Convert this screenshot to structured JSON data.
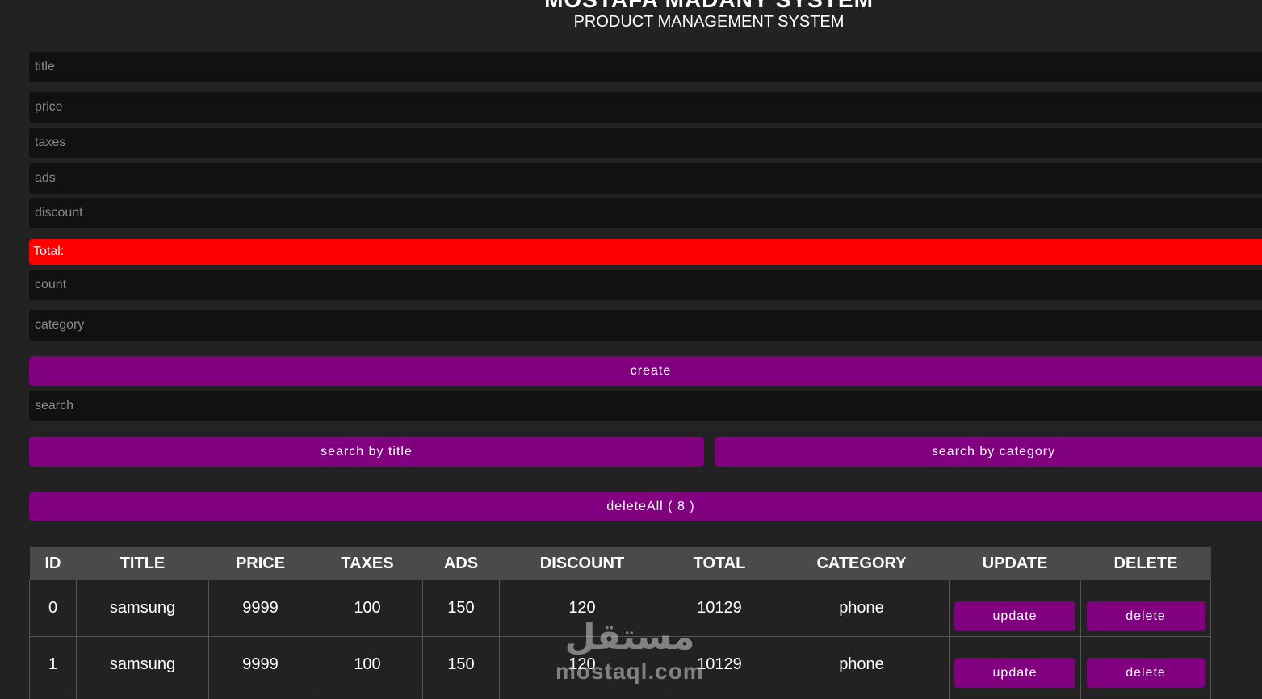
{
  "header": {
    "title": "MOSTAFA MADANY SYSTEM",
    "subtitle": "PRODUCT MANAGEMENT SYSTEM"
  },
  "form": {
    "title_placeholder": "title",
    "price_placeholder": "price",
    "taxes_placeholder": "taxes",
    "ads_placeholder": "ads",
    "discount_placeholder": "discount",
    "total_label": "Total:",
    "count_placeholder": "count",
    "category_placeholder": "category",
    "create_label": "create"
  },
  "search": {
    "placeholder": "search",
    "by_title_label": "search by title",
    "by_category_label": "search by category"
  },
  "delete_all_label": "deleteAll ( 8 )",
  "table": {
    "headers": [
      "ID",
      "TITLE",
      "PRICE",
      "TAXES",
      "ADS",
      "DISCOUNT",
      "TOTAL",
      "CATEGORY",
      "UPDATE",
      "DELETE"
    ],
    "rows": [
      {
        "id": "0",
        "title": "samsung",
        "price": "9999",
        "taxes": "100",
        "ads": "150",
        "discount": "120",
        "total": "10129",
        "category": "phone",
        "update": "update",
        "delete": "delete"
      },
      {
        "id": "1",
        "title": "samsung",
        "price": "9999",
        "taxes": "100",
        "ads": "150",
        "discount": "120",
        "total": "10129",
        "category": "phone",
        "update": "update",
        "delete": "delete"
      }
    ]
  },
  "watermark": {
    "arabic": "مستقل",
    "latin": "mostaql.com"
  },
  "colors": {
    "background": "#222222",
    "input": "#111111",
    "accent": "#800080",
    "total": "#ff0000"
  }
}
